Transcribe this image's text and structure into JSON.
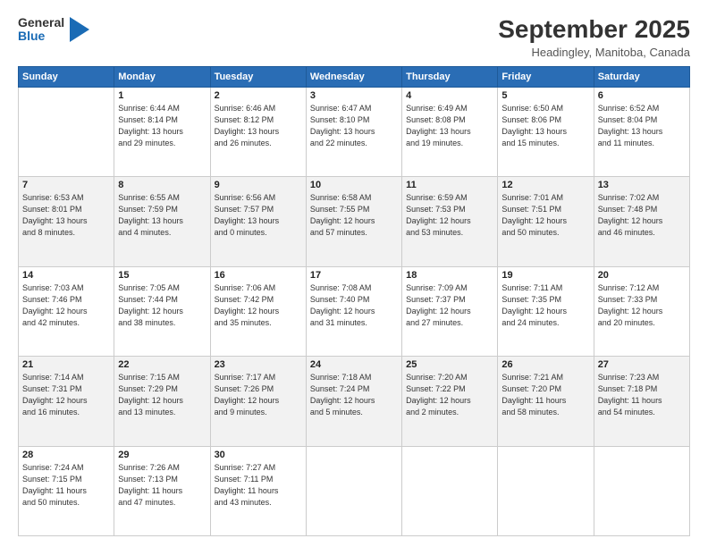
{
  "header": {
    "logo_general": "General",
    "logo_blue": "Blue",
    "month": "September 2025",
    "location": "Headingley, Manitoba, Canada"
  },
  "days_of_week": [
    "Sunday",
    "Monday",
    "Tuesday",
    "Wednesday",
    "Thursday",
    "Friday",
    "Saturday"
  ],
  "weeks": [
    [
      {
        "day": "",
        "info": ""
      },
      {
        "day": "1",
        "info": "Sunrise: 6:44 AM\nSunset: 8:14 PM\nDaylight: 13 hours\nand 29 minutes."
      },
      {
        "day": "2",
        "info": "Sunrise: 6:46 AM\nSunset: 8:12 PM\nDaylight: 13 hours\nand 26 minutes."
      },
      {
        "day": "3",
        "info": "Sunrise: 6:47 AM\nSunset: 8:10 PM\nDaylight: 13 hours\nand 22 minutes."
      },
      {
        "day": "4",
        "info": "Sunrise: 6:49 AM\nSunset: 8:08 PM\nDaylight: 13 hours\nand 19 minutes."
      },
      {
        "day": "5",
        "info": "Sunrise: 6:50 AM\nSunset: 8:06 PM\nDaylight: 13 hours\nand 15 minutes."
      },
      {
        "day": "6",
        "info": "Sunrise: 6:52 AM\nSunset: 8:04 PM\nDaylight: 13 hours\nand 11 minutes."
      }
    ],
    [
      {
        "day": "7",
        "info": "Sunrise: 6:53 AM\nSunset: 8:01 PM\nDaylight: 13 hours\nand 8 minutes."
      },
      {
        "day": "8",
        "info": "Sunrise: 6:55 AM\nSunset: 7:59 PM\nDaylight: 13 hours\nand 4 minutes."
      },
      {
        "day": "9",
        "info": "Sunrise: 6:56 AM\nSunset: 7:57 PM\nDaylight: 13 hours\nand 0 minutes."
      },
      {
        "day": "10",
        "info": "Sunrise: 6:58 AM\nSunset: 7:55 PM\nDaylight: 12 hours\nand 57 minutes."
      },
      {
        "day": "11",
        "info": "Sunrise: 6:59 AM\nSunset: 7:53 PM\nDaylight: 12 hours\nand 53 minutes."
      },
      {
        "day": "12",
        "info": "Sunrise: 7:01 AM\nSunset: 7:51 PM\nDaylight: 12 hours\nand 50 minutes."
      },
      {
        "day": "13",
        "info": "Sunrise: 7:02 AM\nSunset: 7:48 PM\nDaylight: 12 hours\nand 46 minutes."
      }
    ],
    [
      {
        "day": "14",
        "info": "Sunrise: 7:03 AM\nSunset: 7:46 PM\nDaylight: 12 hours\nand 42 minutes."
      },
      {
        "day": "15",
        "info": "Sunrise: 7:05 AM\nSunset: 7:44 PM\nDaylight: 12 hours\nand 38 minutes."
      },
      {
        "day": "16",
        "info": "Sunrise: 7:06 AM\nSunset: 7:42 PM\nDaylight: 12 hours\nand 35 minutes."
      },
      {
        "day": "17",
        "info": "Sunrise: 7:08 AM\nSunset: 7:40 PM\nDaylight: 12 hours\nand 31 minutes."
      },
      {
        "day": "18",
        "info": "Sunrise: 7:09 AM\nSunset: 7:37 PM\nDaylight: 12 hours\nand 27 minutes."
      },
      {
        "day": "19",
        "info": "Sunrise: 7:11 AM\nSunset: 7:35 PM\nDaylight: 12 hours\nand 24 minutes."
      },
      {
        "day": "20",
        "info": "Sunrise: 7:12 AM\nSunset: 7:33 PM\nDaylight: 12 hours\nand 20 minutes."
      }
    ],
    [
      {
        "day": "21",
        "info": "Sunrise: 7:14 AM\nSunset: 7:31 PM\nDaylight: 12 hours\nand 16 minutes."
      },
      {
        "day": "22",
        "info": "Sunrise: 7:15 AM\nSunset: 7:29 PM\nDaylight: 12 hours\nand 13 minutes."
      },
      {
        "day": "23",
        "info": "Sunrise: 7:17 AM\nSunset: 7:26 PM\nDaylight: 12 hours\nand 9 minutes."
      },
      {
        "day": "24",
        "info": "Sunrise: 7:18 AM\nSunset: 7:24 PM\nDaylight: 12 hours\nand 5 minutes."
      },
      {
        "day": "25",
        "info": "Sunrise: 7:20 AM\nSunset: 7:22 PM\nDaylight: 12 hours\nand 2 minutes."
      },
      {
        "day": "26",
        "info": "Sunrise: 7:21 AM\nSunset: 7:20 PM\nDaylight: 11 hours\nand 58 minutes."
      },
      {
        "day": "27",
        "info": "Sunrise: 7:23 AM\nSunset: 7:18 PM\nDaylight: 11 hours\nand 54 minutes."
      }
    ],
    [
      {
        "day": "28",
        "info": "Sunrise: 7:24 AM\nSunset: 7:15 PM\nDaylight: 11 hours\nand 50 minutes."
      },
      {
        "day": "29",
        "info": "Sunrise: 7:26 AM\nSunset: 7:13 PM\nDaylight: 11 hours\nand 47 minutes."
      },
      {
        "day": "30",
        "info": "Sunrise: 7:27 AM\nSunset: 7:11 PM\nDaylight: 11 hours\nand 43 minutes."
      },
      {
        "day": "",
        "info": ""
      },
      {
        "day": "",
        "info": ""
      },
      {
        "day": "",
        "info": ""
      },
      {
        "day": "",
        "info": ""
      }
    ]
  ]
}
